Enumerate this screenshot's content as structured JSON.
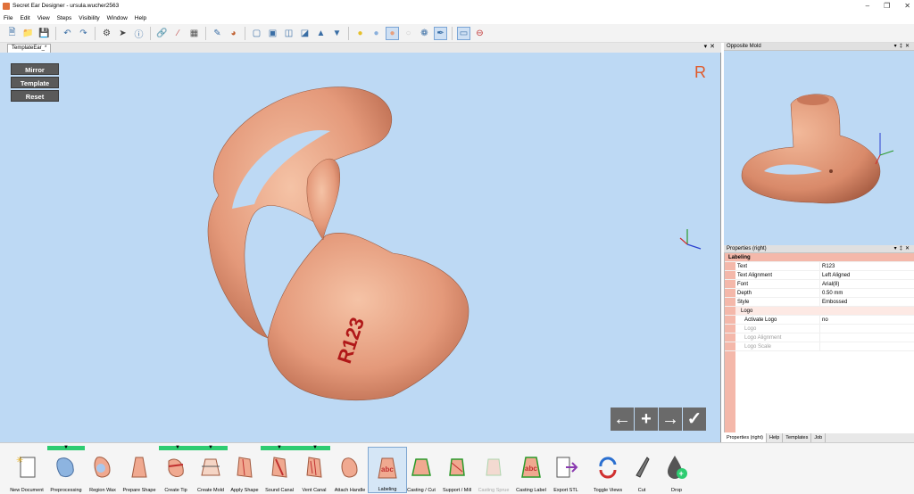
{
  "window": {
    "title": "Secret Ear Designer - ursula.wucher2563"
  },
  "menu": [
    "File",
    "Edit",
    "View",
    "Steps",
    "Visibility",
    "Window",
    "Help"
  ],
  "doc_tab": "TemplateEar_*",
  "viewport": {
    "buttons": [
      "Mirror",
      "Template",
      "Reset"
    ],
    "side_indicator": "R",
    "nav_buttons": [
      "←",
      "+",
      "→",
      "✓"
    ]
  },
  "model": {
    "label_text": "R123",
    "color": "#e8a07e"
  },
  "opposite_mold": {
    "title": "Opposite Mold"
  },
  "properties": {
    "title": "Properties (right)",
    "section": "Labeling",
    "rows": [
      {
        "key": "Text",
        "value": "R123"
      },
      {
        "key": "Text Alignment",
        "value": "Left Aligned"
      },
      {
        "key": "Font",
        "value": "Arial(8)"
      },
      {
        "key": "Depth",
        "value": "0.50 mm"
      },
      {
        "key": "Style",
        "value": "Embossed"
      }
    ],
    "logo_section": "Logo",
    "logo_rows": [
      {
        "key": "Activate Logo",
        "value": "no"
      },
      {
        "key": "Logo",
        "value": ""
      },
      {
        "key": "Logo Alignment",
        "value": ""
      },
      {
        "key": "Logo Scale",
        "value": ""
      }
    ]
  },
  "bottom_tabs": [
    "Properties (right)",
    "Help",
    "Templates",
    "Job"
  ],
  "workflow": [
    {
      "label": "New Document",
      "icon": "new-document-icon"
    },
    {
      "label": "Preprocessing",
      "icon": "preprocessing-icon"
    },
    {
      "label": "Region Wax",
      "icon": "region-wax-icon"
    },
    {
      "label": "Prepare Shape",
      "icon": "prepare-shape-icon"
    },
    {
      "label": "Create Tip",
      "icon": "create-tip-icon"
    },
    {
      "label": "Create Mold",
      "icon": "create-mold-icon"
    },
    {
      "label": "Apply Shape",
      "icon": "apply-shape-icon"
    },
    {
      "label": "Sound Canal",
      "icon": "sound-canal-icon"
    },
    {
      "label": "Vent Canal",
      "icon": "vent-canal-icon"
    },
    {
      "label": "Attach Handle",
      "icon": "attach-handle-icon"
    },
    {
      "label": "Labeling",
      "icon": "labeling-icon"
    },
    {
      "label": "Casting / Cut",
      "icon": "casting-cut-icon"
    },
    {
      "label": "Support / Mill",
      "icon": "support-mill-icon"
    },
    {
      "label": "Casting Sprue",
      "icon": "casting-sprue-icon"
    },
    {
      "label": "Casting Label",
      "icon": "casting-label-icon"
    },
    {
      "label": "Export STL",
      "icon": "export-stl-icon"
    },
    {
      "label": "Toggle Views",
      "icon": "toggle-views-icon"
    },
    {
      "label": "Cut",
      "icon": "cut-icon"
    },
    {
      "label": "Drop",
      "icon": "drop-icon"
    }
  ],
  "colors": {
    "accent": "#2ecc71",
    "viewport_bg": "#bdd9f4",
    "label_red": "#b01818",
    "section_bg": "#f4b8aa"
  }
}
